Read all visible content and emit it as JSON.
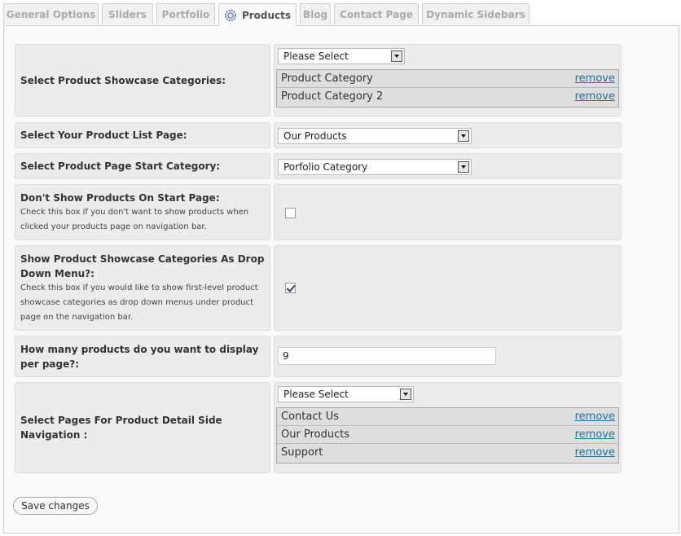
{
  "tabs": [
    {
      "label": "General Options"
    },
    {
      "label": "Sliders"
    },
    {
      "label": "Portfolio"
    },
    {
      "label": "Products"
    },
    {
      "label": "Blog"
    },
    {
      "label": "Contact Page"
    },
    {
      "label": "Dynamic Sidebars"
    }
  ],
  "active_tab": "Products",
  "showcase": {
    "label": "Select Product Showcase Categories:",
    "select": "Please Select",
    "items": [
      {
        "name": "Product Category",
        "remove": "remove"
      },
      {
        "name": "Product Category 2",
        "remove": "remove"
      }
    ]
  },
  "list_page": {
    "label": "Select Your Product List Page:",
    "select": "Our Products"
  },
  "start_category": {
    "label": "Select Product Page Start Category:",
    "select": "Porfolio Category"
  },
  "dont_show": {
    "label": "Don't Show Products On Start Page:",
    "desc1": "Check this box if you don't want to show products when",
    "desc2": "clicked your products page on navigation bar.",
    "checked": false
  },
  "dropdown_menu": {
    "label1": "Show Product Showcase Categories As Drop",
    "label2": "Down Menu?:",
    "desc1": "Check this box if you would like to show first-level product",
    "desc2": "showcase categories as drop down menus under product",
    "desc3": "page on the navigation bar.",
    "checked": true
  },
  "per_page": {
    "label1": "How many products do you want to display",
    "label2": "per page?:",
    "value": "9"
  },
  "side_nav": {
    "label1": "Select Pages For Product Detail Side",
    "label2": "Navigation :",
    "select": "Please Select",
    "items": [
      {
        "name": "Contact Us",
        "remove": "remove"
      },
      {
        "name": "Our Products",
        "remove": "remove"
      },
      {
        "name": "Support",
        "remove": "remove"
      }
    ]
  },
  "save_label": "Save changes"
}
